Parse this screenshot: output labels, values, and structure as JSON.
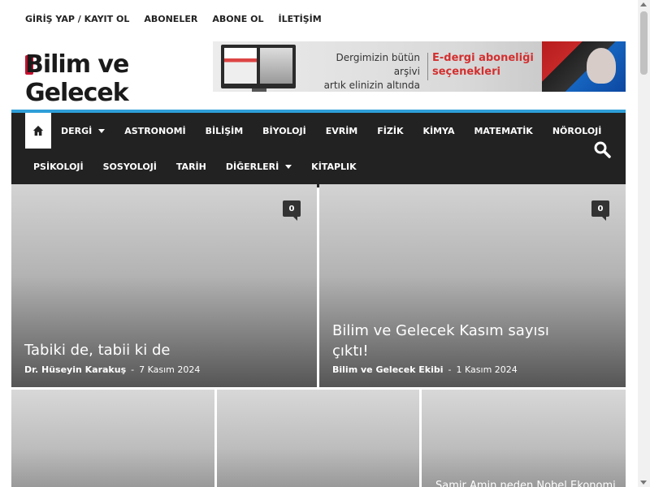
{
  "topbar": {
    "links": [
      "GİRİŞ YAP / KAYIT OL",
      "ABONELER",
      "ABONE OL",
      "İLETİŞİM"
    ]
  },
  "logo": {
    "text": "Bilim ve Gelecek"
  },
  "banner": {
    "line1": "Dergimizin bütün arşivi",
    "line2": "artık elinizin altında",
    "offer1": "E-dergi aboneliği",
    "offer2": "seçenekleri"
  },
  "nav": {
    "row1": [
      "DERGİ",
      "ASTRONOMİ",
      "BİLİŞİM",
      "BİYOLOJİ",
      "EVRİM",
      "FİZİK",
      "KİMYA",
      "MATEMATİK",
      "NÖROLOJİ"
    ],
    "row2": [
      "PSİKOLOJİ",
      "SOSYOLOJİ",
      "TARİH",
      "DİĞERLERİ",
      "KİTAPLIK"
    ],
    "accent": "#2e9fd8",
    "background": "#222222"
  },
  "featured": [
    {
      "title": "Tabiki de, tabii ki de",
      "author": "Dr. Hüseyin Karakuş",
      "date": "7 Kasım 2024",
      "comments": "0"
    },
    {
      "title_line1": "Bilim ve Gelecek Kasım sayısı",
      "title_line2": "çıktı!",
      "author": "Bilim ve Gelecek Ekibi",
      "date": "1 Kasım 2024",
      "comments": "0"
    }
  ],
  "small_cards": [
    {
      "title": ""
    },
    {
      "title": ""
    },
    {
      "title": "Samir Amin neden Nobel Ekonomi"
    }
  ]
}
